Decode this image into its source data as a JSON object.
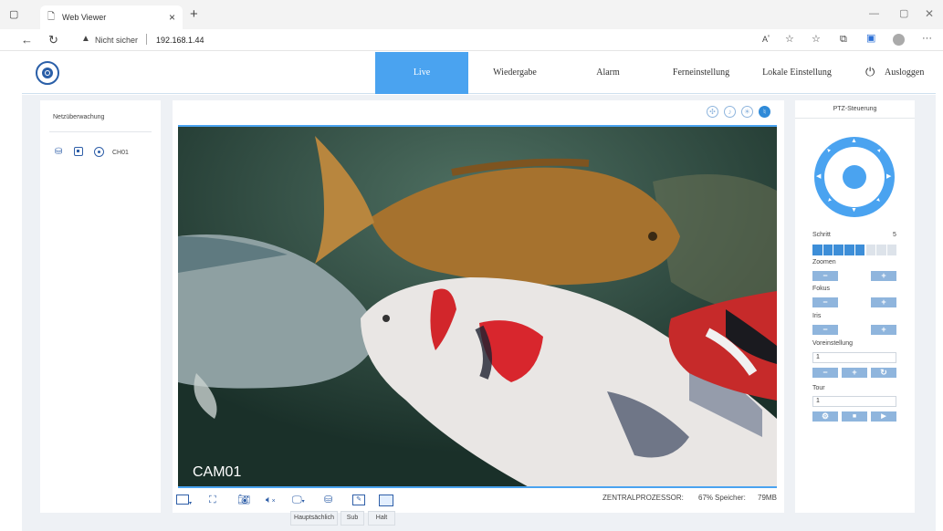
{
  "browser": {
    "tab_title": "Web Viewer",
    "close_glyph": "×",
    "new_tab_glyph": "+",
    "security_label": "Nicht sicher",
    "url": "192.168.1.44"
  },
  "nav": {
    "items": [
      {
        "label": "Live",
        "active": true
      },
      {
        "label": "Wiedergabe"
      },
      {
        "label": "Alarm"
      },
      {
        "label": "Ferneinstellung"
      },
      {
        "label": "Lokale Einstellung"
      }
    ],
    "logout_label": "Ausloggen"
  },
  "left_panel": {
    "title": "Netzüberwachung",
    "channel_label": "CH01"
  },
  "video": {
    "camera_label": "CAM01"
  },
  "status": {
    "cpu_label": "ZENTRALPROZESSOR:",
    "cpu_value": "67%",
    "memory_label": "Speicher:",
    "memory_value": "79MB"
  },
  "stream_buttons": [
    "Hauptsächlich",
    "Sub",
    "Halt"
  ],
  "ptz": {
    "title": "PTZ-Steuerung",
    "step_label": "Schritt",
    "step_value": "5",
    "step_level": 5,
    "step_max": 8,
    "zoom_label": "Zoomen",
    "focus_label": "Fokus",
    "iris_label": "Iris",
    "minus": "−",
    "plus": "+",
    "preset_label": "Voreinstellung",
    "preset_value": "1",
    "tour_label": "Tour",
    "tour_value": "1",
    "refresh_glyph": "↻",
    "gear_glyph": "⚙",
    "stop_glyph": "■",
    "play_glyph": "▶"
  },
  "colors": {
    "accent": "#4aa3f0",
    "ptz_button": "#8fb5dd",
    "step_on": "#3d8ed8",
    "step_off": "#dde3ea"
  }
}
